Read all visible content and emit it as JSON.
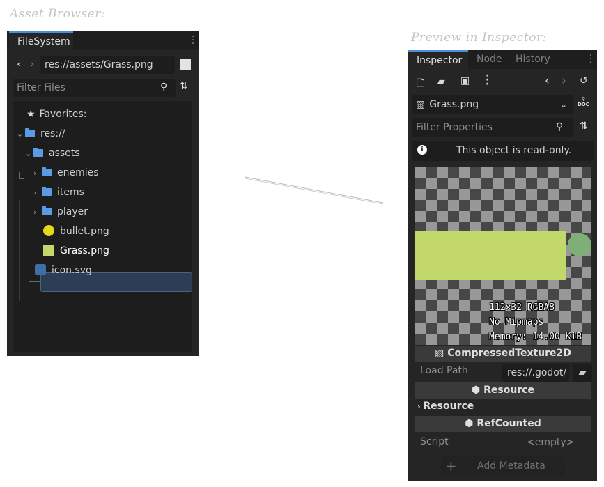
{
  "captions": {
    "asset_browser": "Asset Browser:",
    "inspector_preview": "Preview in Inspector:"
  },
  "filesystem": {
    "tab": "FileSystem",
    "path": "res://assets/Grass.png",
    "filter_placeholder": "Filter Files",
    "tree": {
      "favorites": "Favorites:",
      "root": "res://",
      "assets": "assets",
      "enemies": "enemies",
      "items": "items",
      "player": "player",
      "bullet": "bullet.png",
      "grass": "Grass.png",
      "icon": "icon.svg"
    }
  },
  "inspector": {
    "tabs": [
      "Inspector",
      "Node",
      "History"
    ],
    "resource_name": "Grass.png",
    "filter_placeholder": "Filter Properties",
    "readonly_notice": "This object is read-only.",
    "preview_info": [
      "112×32 RGBA8",
      "No Mipmaps",
      "Memory: 14.00 KiB"
    ],
    "section_compressed": "CompressedTexture2D",
    "load_path_label": "Load Path",
    "load_path_value": "res://.godot/",
    "section_resource": "Resource",
    "resource_group": "Resource",
    "section_refcounted": "RefCounted",
    "script_label": "Script",
    "script_value": "<empty>",
    "add_metadata": "Add Metadata",
    "doc_label": "DOC"
  },
  "colors": {
    "accent": "#4a8ee0",
    "folder": "#5a9be3",
    "panel": "#252525"
  }
}
